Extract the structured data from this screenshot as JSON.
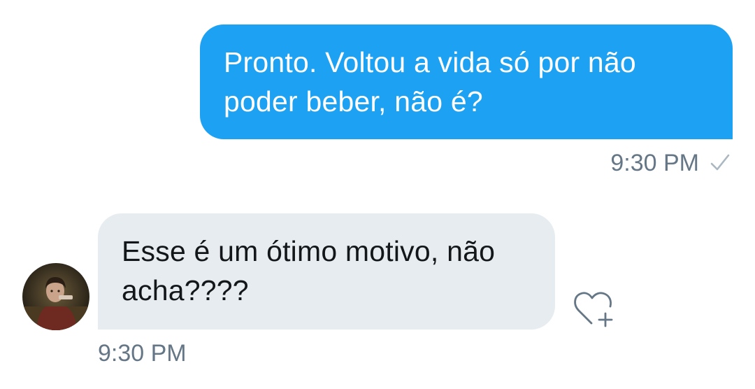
{
  "conversation": {
    "messages": [
      {
        "direction": "outgoing",
        "text": "Pronto. Voltou a vida só por não poder beber, não é?",
        "time": "9:30 PM",
        "status_icon": "check-icon"
      },
      {
        "direction": "incoming",
        "text": "Esse é um ótimo motivo, não acha????",
        "time": "9:30 PM",
        "avatar_icon": "avatar",
        "reaction_icon": "heart-plus-icon"
      }
    ]
  },
  "colors": {
    "outgoing_bubble": "#1da1f2",
    "incoming_bubble": "#e6ecf0",
    "timestamp": "#657786",
    "text_dark": "#14171a"
  }
}
